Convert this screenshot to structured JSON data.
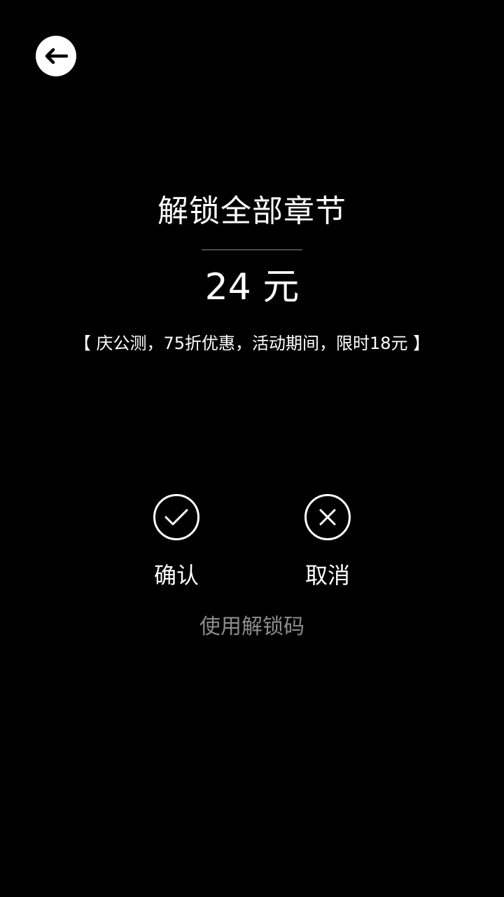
{
  "header": {
    "back_icon": "arrow-left-icon"
  },
  "unlock": {
    "title": "解锁全部章节",
    "price": "24 元",
    "promo": "【 庆公测，75折优惠，活动期间，限时18元 】"
  },
  "actions": {
    "confirm_label": "确认",
    "confirm_icon": "check-icon",
    "cancel_label": "取消",
    "cancel_icon": "x-icon",
    "unlock_code_label": "使用解锁码"
  },
  "colors": {
    "background": "#000000",
    "foreground": "#ffffff",
    "muted": "#8c8c8c"
  }
}
